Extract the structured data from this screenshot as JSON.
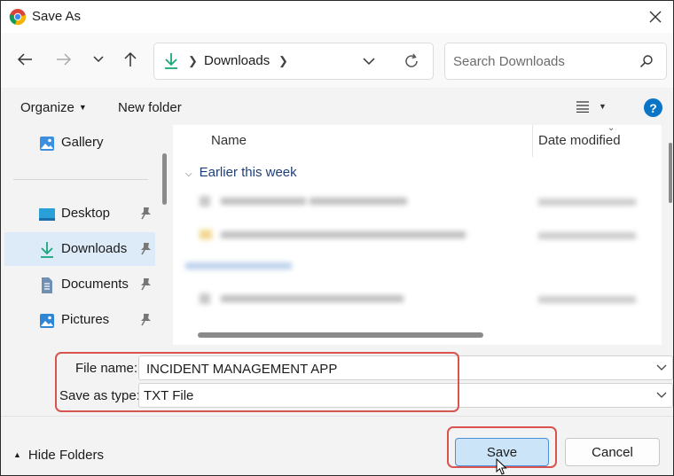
{
  "window": {
    "title": "Save As"
  },
  "nav": {
    "back_icon": "back-arrow-icon",
    "forward_icon": "forward-arrow-icon",
    "recent_icon": "chevron-down-icon",
    "up_icon": "up-arrow-icon",
    "breadcrumb": "Downloads",
    "search_placeholder": "Search Downloads"
  },
  "command_bar": {
    "organize": "Organize",
    "new_folder": "New folder",
    "help": "?"
  },
  "sidebar": {
    "items": [
      {
        "label": "Gallery",
        "icon": "gallery-icon",
        "pinned": false
      },
      {
        "label": "Desktop",
        "icon": "desktop-icon",
        "pinned": true
      },
      {
        "label": "Downloads",
        "icon": "download-icon",
        "pinned": true,
        "selected": true
      },
      {
        "label": "Documents",
        "icon": "document-icon",
        "pinned": true
      },
      {
        "label": "Pictures",
        "icon": "pictures-icon",
        "pinned": true
      }
    ]
  },
  "file_list": {
    "columns": [
      "Name",
      "Date modified"
    ],
    "group": "Earlier this week"
  },
  "form": {
    "file_name_label": "File name:",
    "file_name_value": "INCIDENT MANAGEMENT APP",
    "type_label": "Save as type:",
    "type_value": "TXT File"
  },
  "footer": {
    "hide_folders": "Hide Folders",
    "save": "Save",
    "cancel": "Cancel"
  },
  "colors": {
    "accent": "#0a74c6",
    "selection": "#dcebf7",
    "annotation_red": "#d9534f",
    "save_button_bg": "#cce4f7",
    "download_green": "#1aa77c"
  }
}
